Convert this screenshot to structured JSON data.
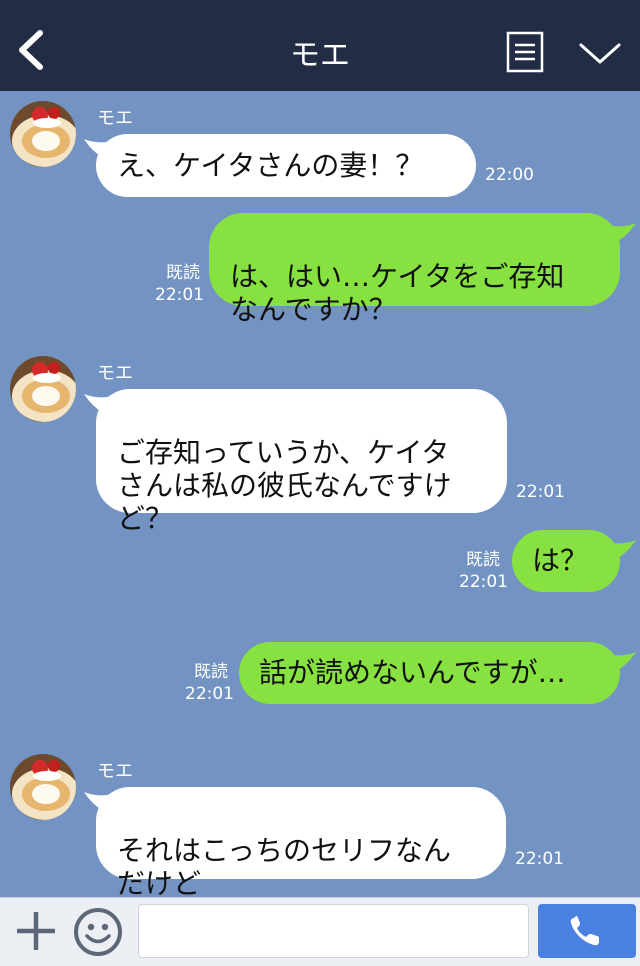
{
  "header": {
    "title": "モエ"
  },
  "messages": [
    {
      "side": "in",
      "sender": "モエ",
      "text": "え、ケイタさんの妻！？",
      "time": "22:00"
    },
    {
      "side": "out",
      "read": "既読",
      "text": "は、はい…ケイタをご存知\nなんですか？",
      "time": "22:01"
    },
    {
      "side": "in",
      "sender": "モエ",
      "text": "ご存知っていうか、ケイタ\nさんは私の彼氏なんですけ\nど？",
      "time": "22:01"
    },
    {
      "side": "out",
      "read": "既読",
      "text": "は？",
      "time": "22:01"
    },
    {
      "side": "out",
      "read": "既読",
      "text": "話が読めないんですが…",
      "time": "22:01"
    },
    {
      "side": "in",
      "sender": "モエ",
      "text": "それはこっちのセリフなん\nだけど",
      "time": "22:01"
    }
  ],
  "composer": {
    "placeholder": ""
  },
  "colors": {
    "header": "#222c45",
    "chat_bg": "#7394c3",
    "outgoing_bubble": "#86e141",
    "incoming_bubble": "#ffffff",
    "call_button": "#4a80e0"
  }
}
